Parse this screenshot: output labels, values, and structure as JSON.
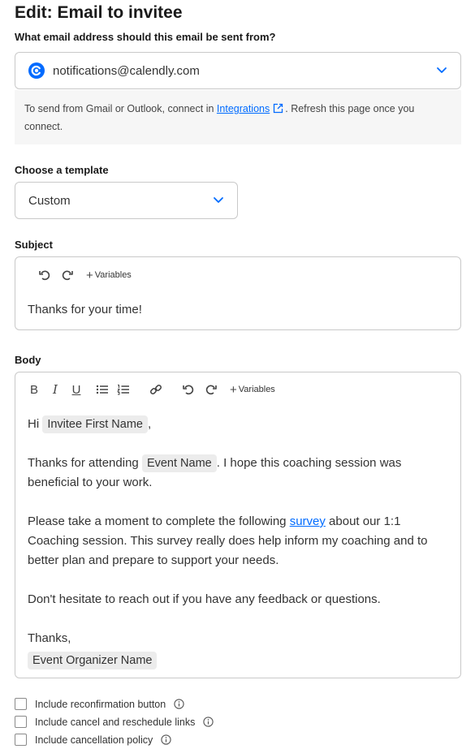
{
  "page": {
    "title": "Edit: Email to invitee"
  },
  "sender": {
    "label": "What email address should this email be sent from?",
    "value": "notifications@calendly.com",
    "note_before": "To send from Gmail or Outlook, connect in ",
    "note_link": "Integrations",
    "note_after": ". Refresh this page once you connect."
  },
  "template": {
    "label": "Choose a template",
    "value": "Custom"
  },
  "subject": {
    "label": "Subject",
    "variables_label": "Variables",
    "value": "Thanks for your time!"
  },
  "body": {
    "label": "Body",
    "variables_label": "Variables",
    "greeting": "Hi",
    "greeting_var": "Invitee First Name",
    "greeting_after": ",",
    "p2_before": "Thanks for attending",
    "p2_var": "Event Name",
    "p2_after": ". I hope this coaching session was beneficial to your work.",
    "p3_before": "Please take a moment to complete the following ",
    "p3_link": "survey",
    "p3_after": " about our 1:1 Coaching session. This survey really does help inform my coaching and to better plan and prepare to support your needs.",
    "p4": "Don't hesitate to reach out if you have any feedback or questions.",
    "signoff": "Thanks,",
    "signoff_var": "Event Organizer Name"
  },
  "options": [
    {
      "label": "Include reconfirmation button",
      "checked": false
    },
    {
      "label": "Include cancel and reschedule links",
      "checked": false
    },
    {
      "label": "Include cancellation policy",
      "checked": false
    }
  ],
  "colors": {
    "accent": "#006bff",
    "border": "#c9c9c9",
    "chip": "#ececec",
    "note_bg": "#f6f6f6"
  },
  "icons": [
    "calendly-logo-icon",
    "chevron-down-icon",
    "external-link-icon",
    "undo-icon",
    "redo-icon",
    "plus-icon",
    "bold-icon",
    "italic-icon",
    "underline-icon",
    "bulleted-list-icon",
    "numbered-list-icon",
    "link-icon",
    "info-icon"
  ]
}
